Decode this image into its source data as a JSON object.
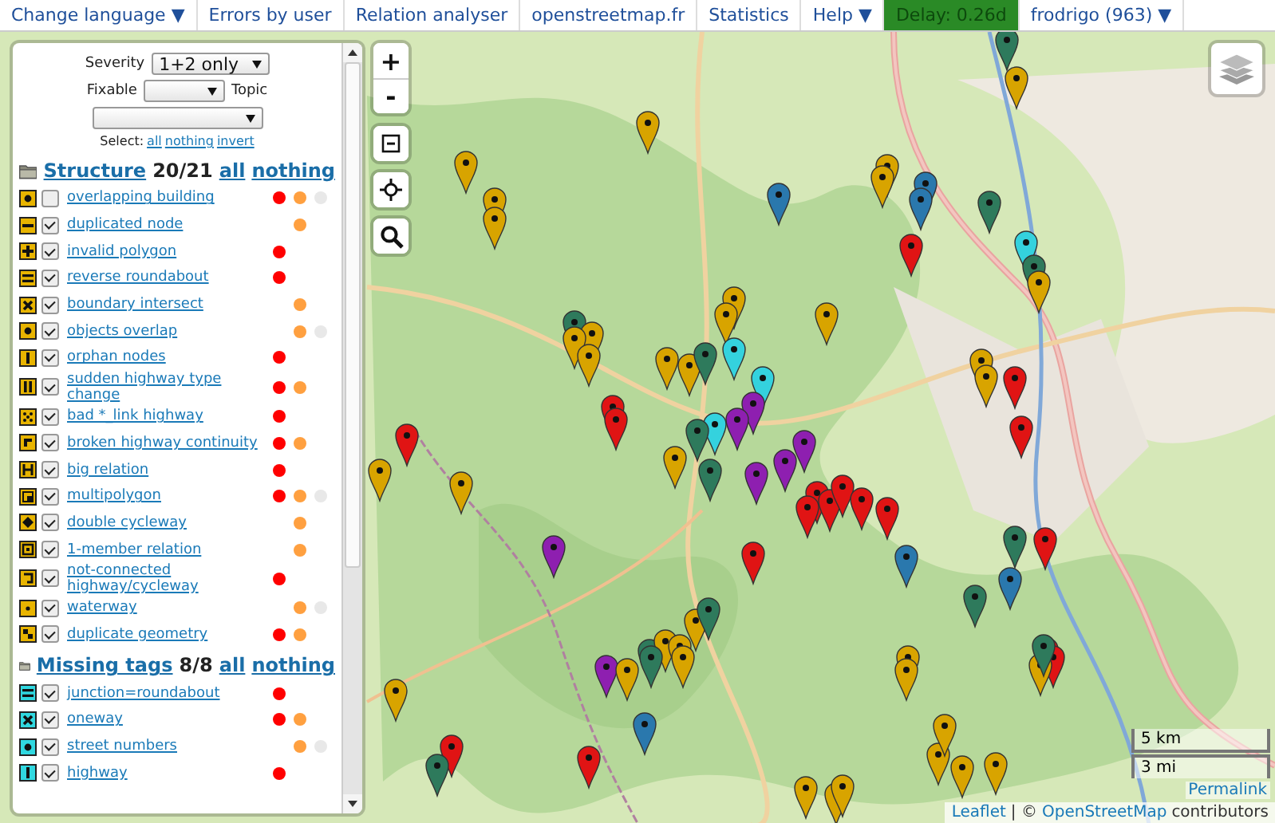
{
  "nav": [
    {
      "label": "Change language ▼",
      "kind": "menu"
    },
    {
      "label": "Errors by user",
      "kind": "link"
    },
    {
      "label": "Relation analyser",
      "kind": "link"
    },
    {
      "label": "openstreetmap.fr",
      "kind": "link"
    },
    {
      "label": "Statistics",
      "kind": "link"
    },
    {
      "label": "Help ▼",
      "kind": "menu"
    },
    {
      "label": "Delay: 0.26d",
      "kind": "status"
    },
    {
      "label": "frodrigo (963) ▼",
      "kind": "menu"
    }
  ],
  "filters": {
    "severity_label": "Severity",
    "severity_value": "1+2 only",
    "fixable_label": "Fixable",
    "topic_label": "Topic",
    "select_label": "Select:",
    "select_links": [
      "all",
      "nothing",
      "invert"
    ]
  },
  "groups": [
    {
      "title": "Structure",
      "count": "20/21",
      "links": [
        "all",
        "nothing"
      ],
      "color": "#e8b400",
      "items": [
        {
          "label": "overlapping building",
          "checked": false,
          "severity_1": true,
          "severity_2": true,
          "severity_3": true
        },
        {
          "label": "duplicated node",
          "checked": true,
          "severity_1": false,
          "severity_2": true,
          "severity_3": false
        },
        {
          "label": "invalid polygon",
          "checked": true,
          "severity_1": true,
          "severity_2": false,
          "severity_3": false
        },
        {
          "label": "reverse roundabout",
          "checked": true,
          "severity_1": true,
          "severity_2": false,
          "severity_3": false
        },
        {
          "label": "boundary intersect",
          "checked": true,
          "severity_1": false,
          "severity_2": true,
          "severity_3": false
        },
        {
          "label": "objects overlap",
          "checked": true,
          "severity_1": false,
          "severity_2": true,
          "severity_3": true
        },
        {
          "label": "orphan nodes",
          "checked": true,
          "severity_1": true,
          "severity_2": false,
          "severity_3": false
        },
        {
          "label": "sudden highway type change",
          "checked": true,
          "severity_1": true,
          "severity_2": true,
          "severity_3": false
        },
        {
          "label": "bad *_link highway",
          "checked": true,
          "severity_1": true,
          "severity_2": false,
          "severity_3": false
        },
        {
          "label": "broken highway continuity",
          "checked": true,
          "severity_1": true,
          "severity_2": true,
          "severity_3": false
        },
        {
          "label": "big relation",
          "checked": true,
          "severity_1": true,
          "severity_2": false,
          "severity_3": false
        },
        {
          "label": "multipolygon",
          "checked": true,
          "severity_1": true,
          "severity_2": true,
          "severity_3": true
        },
        {
          "label": "double cycleway",
          "checked": true,
          "severity_1": false,
          "severity_2": true,
          "severity_3": false
        },
        {
          "label": "1-member relation",
          "checked": true,
          "severity_1": false,
          "severity_2": true,
          "severity_3": false
        },
        {
          "label": "not-connected highway/cycleway",
          "checked": true,
          "severity_1": true,
          "severity_2": false,
          "severity_3": false
        },
        {
          "label": "waterway",
          "checked": true,
          "severity_1": false,
          "severity_2": true,
          "severity_3": true
        },
        {
          "label": "duplicate geometry",
          "checked": true,
          "severity_1": true,
          "severity_2": true,
          "severity_3": false
        }
      ]
    },
    {
      "title": "Missing tags",
      "count": "8/8",
      "links": [
        "all",
        "nothing"
      ],
      "color": "#30d8e0",
      "items": [
        {
          "label": "junction=roundabout",
          "checked": true,
          "severity_1": true,
          "severity_2": false,
          "severity_3": false
        },
        {
          "label": "oneway",
          "checked": true,
          "severity_1": true,
          "severity_2": true,
          "severity_3": false
        },
        {
          "label": "street numbers",
          "checked": true,
          "severity_1": false,
          "severity_2": true,
          "severity_3": true
        },
        {
          "label": "highway",
          "checked": true,
          "severity_1": true,
          "severity_2": false,
          "severity_3": false
        }
      ]
    }
  ],
  "map_controls": {
    "zoom_in": "+",
    "zoom_out": "-"
  },
  "scale": {
    "metric": "5 km",
    "imperial": "3 mi"
  },
  "permalink": "Permalink",
  "attribution": {
    "leaflet": "Leaflet",
    "separator": "| ©",
    "osm": "OpenStreetMap",
    "suffix": "contributors"
  }
}
